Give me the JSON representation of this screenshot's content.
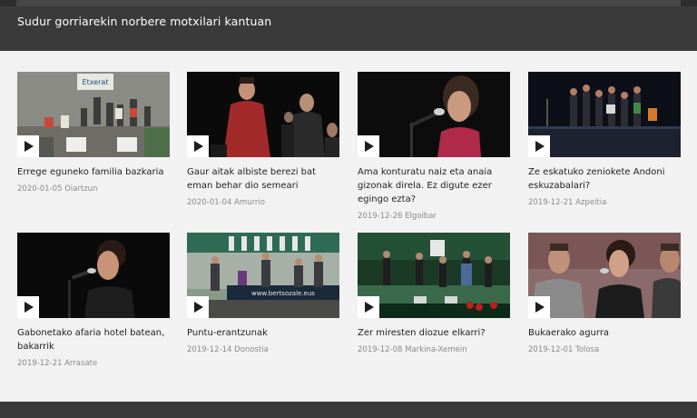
{
  "header": {
    "title": "Sudur gorriarekin norbere motxilari kantuan"
  },
  "videos": [
    {
      "title": "Erregе eguneko familia bazkaria",
      "date": "2020-01-05",
      "place": "Oiartzun",
      "thumb_banner": "Etxerat"
    },
    {
      "title": "Gaur aitak albiste berezi bat eman behar dio semeari",
      "date": "2020-01-04",
      "place": "Amurrio"
    },
    {
      "title": "Ama konturatu naiz eta anaia gizonak direla. Ez digute ezer egingo ezta?",
      "date": "2019-12-26",
      "place": "Elgoibar"
    },
    {
      "title": "Ze eskatuko zeniokete Andoni eskuzabalari?",
      "date": "2019-12-21",
      "place": "Azpeitia"
    },
    {
      "title": "Gabonetako afaria hotel batean, bakarrik",
      "date": "2019-12-21",
      "place": "Arrasate"
    },
    {
      "title": "Puntu-erantzunak",
      "date": "2019-12-14",
      "place": "Donostia",
      "thumb_banner": "www.bertsozale.eus"
    },
    {
      "title": "Zer miresten diozue elkarri?",
      "date": "2019-12-08",
      "place": "Markina-Xemein"
    },
    {
      "title": "Bukaerako agurra",
      "date": "2019-12-01",
      "place": "Tolosa"
    }
  ],
  "colors": {
    "header_bg": "#3a3a3a",
    "content_bg": "#f2f2f2",
    "title_text": "#222222",
    "meta_text": "#8a8a8a"
  },
  "icons": {
    "play": "play-icon"
  }
}
